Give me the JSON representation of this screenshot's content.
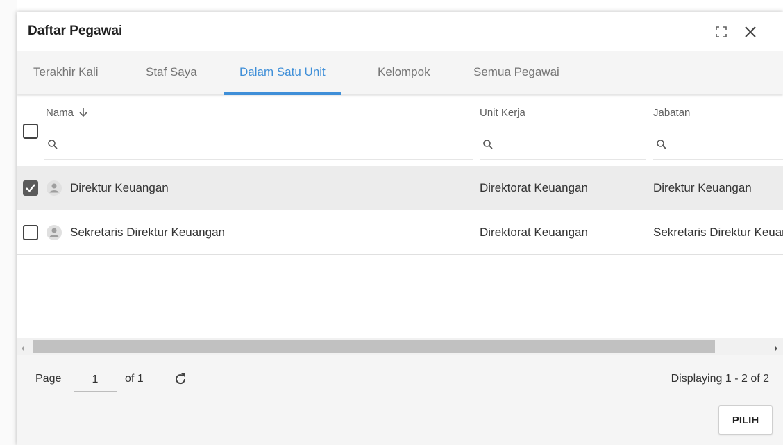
{
  "dialog": {
    "title": "Daftar Pegawai",
    "expand_icon": "expand-icon",
    "close_icon": "close-icon"
  },
  "tabs": [
    {
      "label": "Terakhir Kali",
      "active": false
    },
    {
      "label": "Staf Saya",
      "active": false
    },
    {
      "label": "Dalam Satu Unit",
      "active": true
    },
    {
      "label": "Kelompok",
      "active": false
    },
    {
      "label": "Semua Pegawai",
      "active": false
    }
  ],
  "table": {
    "columns": {
      "nama": "Nama",
      "unit": "Unit Kerja",
      "jabatan": "Jabatan"
    },
    "sort_icon": "arrow-down-icon",
    "rows": [
      {
        "nama": "Direktur Keuangan",
        "unit": "Direktorat Keuangan",
        "jabatan": "Direktur Keuangan",
        "checked": true
      },
      {
        "nama": "Sekretaris Direktur Keuangan",
        "unit": "Direktorat Keuangan",
        "jabatan": "Sekretaris Direktur Keuangan",
        "checked": false
      }
    ]
  },
  "footer": {
    "page_label": "Page",
    "page_value": "1",
    "of_label": "of 1",
    "refresh_icon": "refresh-icon",
    "display_info": "Displaying 1 - 2 of 2",
    "pilih_label": "PILIH"
  },
  "colors": {
    "accent": "#3f8fd8",
    "selected_row": "#ececec",
    "tab_bar": "#f5f5f5"
  }
}
